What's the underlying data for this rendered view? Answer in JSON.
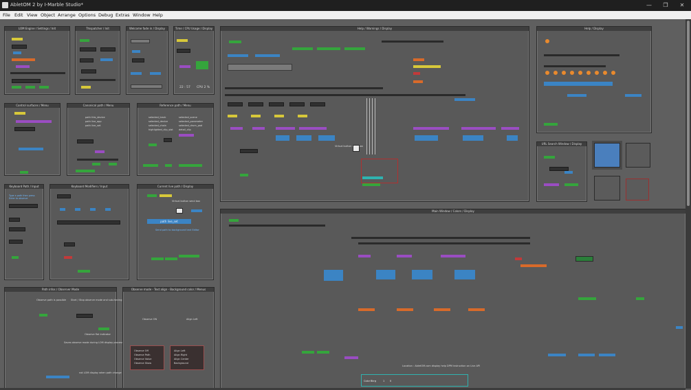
{
  "window": {
    "title": "AbletOM 2 by I-Marble Studio*"
  },
  "menu": [
    "File",
    "Edit",
    "View",
    "Object",
    "Arrange",
    "Options",
    "Debug",
    "Extras",
    "Window",
    "Help"
  ],
  "window_buttons": {
    "minimize": "—",
    "maximize": "❐",
    "close": "✕"
  },
  "panels": {
    "p1": "LOM Engine / Settings / Init",
    "p2": "Thispatcher / Init",
    "p3": "Welcome fade in / Display",
    "p4": "Time / CPU Usage / Display",
    "p5": "Help / Warnings / Display",
    "p6": "Help / Display",
    "p7": "Control surfaces / Menu",
    "p8": "Canonical path / Menu",
    "p9": "Reference path / Menu",
    "p10": "URL Search Window / Display",
    "p11": "Keyboard Path / Input",
    "p12": "Keyboard Modifiers / Input",
    "p13": "Current live path / Display",
    "p14": "Main Window / Colors / Display",
    "p15": "Path infos / Observer Mode",
    "p16": "Observe mode - Text align - Background color / Menus"
  },
  "texts": {
    "cpu_time": "22 : 57",
    "cpu_pct": "CPU 2 %",
    "path_live_set": "path live_set",
    "canonical_lines": [
      "path this_device",
      "path live_app",
      "path live_set"
    ],
    "reference_lines_a": [
      "selected_track",
      "selected_device",
      "selected_chain",
      "highlighted_clip_slot"
    ],
    "reference_lines_b": [
      "selected_scene",
      "selected_parameter",
      "selected_drum_pad",
      "detail_clip"
    ],
    "virtual_btn_1": "Virtual button send box",
    "virtual_btn_2": "Virtual button send box",
    "observe_title": "Observe ON",
    "align_title": "Align Left",
    "send_path": "Send path to background text Editor",
    "observe_opts": [
      "Observe Off",
      "Observe Path",
      "Observe Value",
      "Observe Show"
    ],
    "align_opts": [
      "Align Left",
      "Align Right",
      "Align Center",
      "Background"
    ],
    "path_infos_1": "Observe path is possible",
    "path_infos_2": "Start / Stop observe mode and sub-forcing Internal",
    "path_infos_3": "Observe flat indicator",
    "path_infos_4": "Saves observe mode during LOM display processing",
    "path_infos_5": "not LOM display when path change",
    "bottom_note": "Location : AbletOM.com display help DPM instruction on Live API",
    "color_label_1": "Color",
    "color_label_2": "Bkrg",
    "color_val": "1",
    "color_val_2": "0",
    "keyboard_note": "Type a path then press Enter to observe",
    "help_blue_1": "Shows a full help of every 'Live Object Model' in a web",
    "help_blue_2": "Open in Help"
  },
  "colors": {
    "accent": "#3b84c4",
    "green": "#35a53c",
    "yellow": "#d7c83a",
    "orange": "#d86a2a",
    "purple": "#9a4dc2",
    "red": "#c23a3a"
  }
}
